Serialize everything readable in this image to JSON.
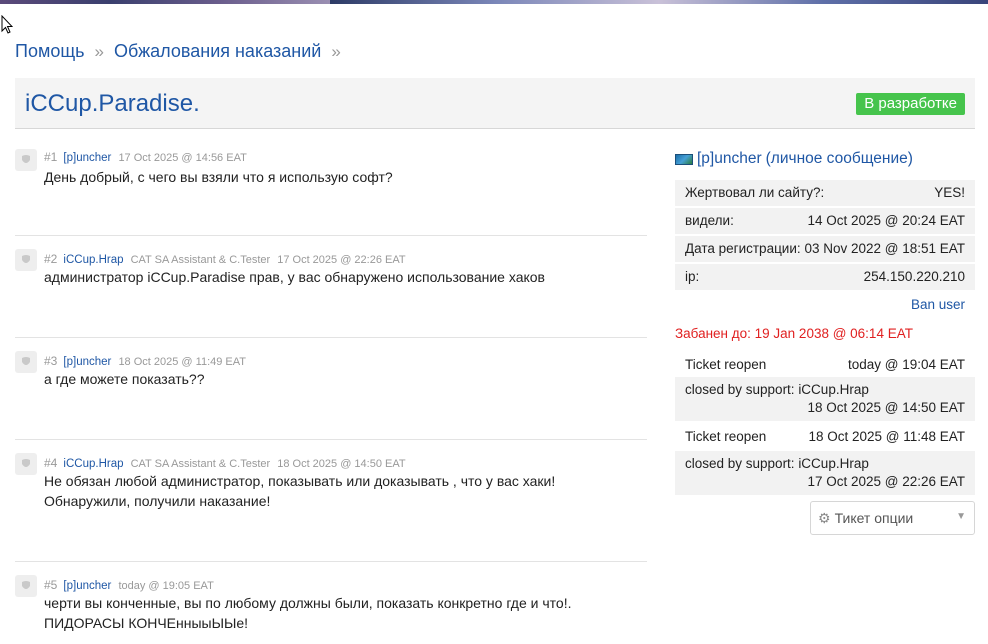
{
  "breadcrumb": [
    {
      "label": "Помощь"
    },
    {
      "label": "Обжалования наказаний"
    }
  ],
  "breadcrumb_separator": "»",
  "page": {
    "title": "iCCup.Paradise.",
    "status": "В разработке",
    "status_color": "#46c44c"
  },
  "posts": [
    {
      "number": "#1",
      "author": "[p]uncher",
      "role": "",
      "time": "17 Oct 2025 @ 14:56 EAT",
      "text": "День добрый, с чего вы взяли что я использую софт?"
    },
    {
      "number": "#2",
      "author": "iCCup.Hrap",
      "role": "CAT SA Assistant & C.Tester",
      "time": "17 Oct 2025 @ 22:26 EAT",
      "text": "администратор iCCup.Paradise прав, у вас обнаружено использование хаков"
    },
    {
      "number": "#3",
      "author": "[p]uncher",
      "role": "",
      "time": "18 Oct 2025 @ 11:49 EAT",
      "text": "а где можете показать??"
    },
    {
      "number": "#4",
      "author": "iCCup.Hrap",
      "role": "CAT SA Assistant & C.Tester",
      "time": "18 Oct 2025 @ 14:50 EAT",
      "text": "Не обязан любой администратор, показывать или доказывать , что у вас хаки! Обнаружили, получили наказание!"
    },
    {
      "number": "#5",
      "author": "[p]uncher",
      "role": "",
      "time": "today @ 19:05 EAT",
      "text": "черти вы конченные, вы по любому должны были, показать конкретно где и что!. ПИДОРАСЫ КОНЧЕнныыЫЫе!"
    }
  ],
  "sidebar": {
    "username": "[p]uncher",
    "pm_link": "(личное сообщение)",
    "info": [
      {
        "label": "Жертвовал ли сайту?:",
        "value": "YES!"
      },
      {
        "label": "видели:",
        "value": "14 Oct 2025 @ 20:24 EAT"
      },
      {
        "label": "Дата регистрации:",
        "value": "03 Nov 2022 @ 18:51 EAT"
      },
      {
        "label": "ip:",
        "value": "254.150.220.210"
      }
    ],
    "ban_link": "Ban user",
    "banned_until": "Забанен до: 19 Jan 2038 @ 06:14 EAT",
    "log": [
      {
        "action": "Ticket reopen",
        "time": "today @ 19:04 EAT"
      },
      {
        "action": "closed by support: iCCup.Hrap",
        "time": "18 Oct 2025 @ 14:50 EAT"
      },
      {
        "action": "Ticket reopen",
        "time": "18 Oct 2025 @ 11:48 EAT"
      },
      {
        "action": "closed by support: iCCup.Hrap",
        "time": "17 Oct 2025 @ 22:26 EAT"
      }
    ],
    "ticket_options": "Тикет опции"
  }
}
